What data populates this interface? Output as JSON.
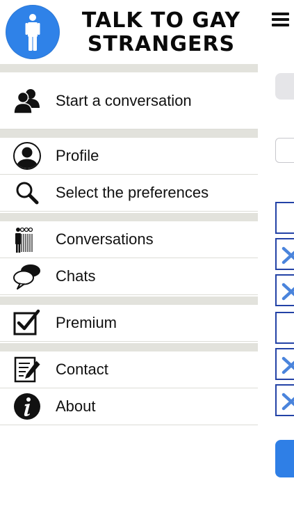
{
  "header": {
    "title_line1": "TALK TO GAY",
    "title_line2": "STRANGERS",
    "logo_icon": "person-icon",
    "logo_color": "#2f82e8"
  },
  "menu": {
    "start_conversation": {
      "label": "Start a conversation",
      "icon": "people-icon"
    },
    "profile": {
      "label": "Profile",
      "icon": "user-avatar-icon"
    },
    "preferences": {
      "label": "Select the preferences",
      "icon": "search-icon"
    },
    "conversations": {
      "label": "Conversations",
      "icon": "queue-people-icon"
    },
    "chats": {
      "label": "Chats",
      "icon": "speech-bubbles-icon"
    },
    "premium": {
      "label": "Premium",
      "icon": "checkbox-checked-icon"
    },
    "contact": {
      "label": "Contact",
      "icon": "write-note-icon"
    },
    "about": {
      "label": "About",
      "icon": "info-icon"
    }
  },
  "peek_panel": {
    "menu_icon": "hamburger-icon",
    "accent_color": "#2f7fe6",
    "checkbox_border_color": "#2342a6"
  }
}
